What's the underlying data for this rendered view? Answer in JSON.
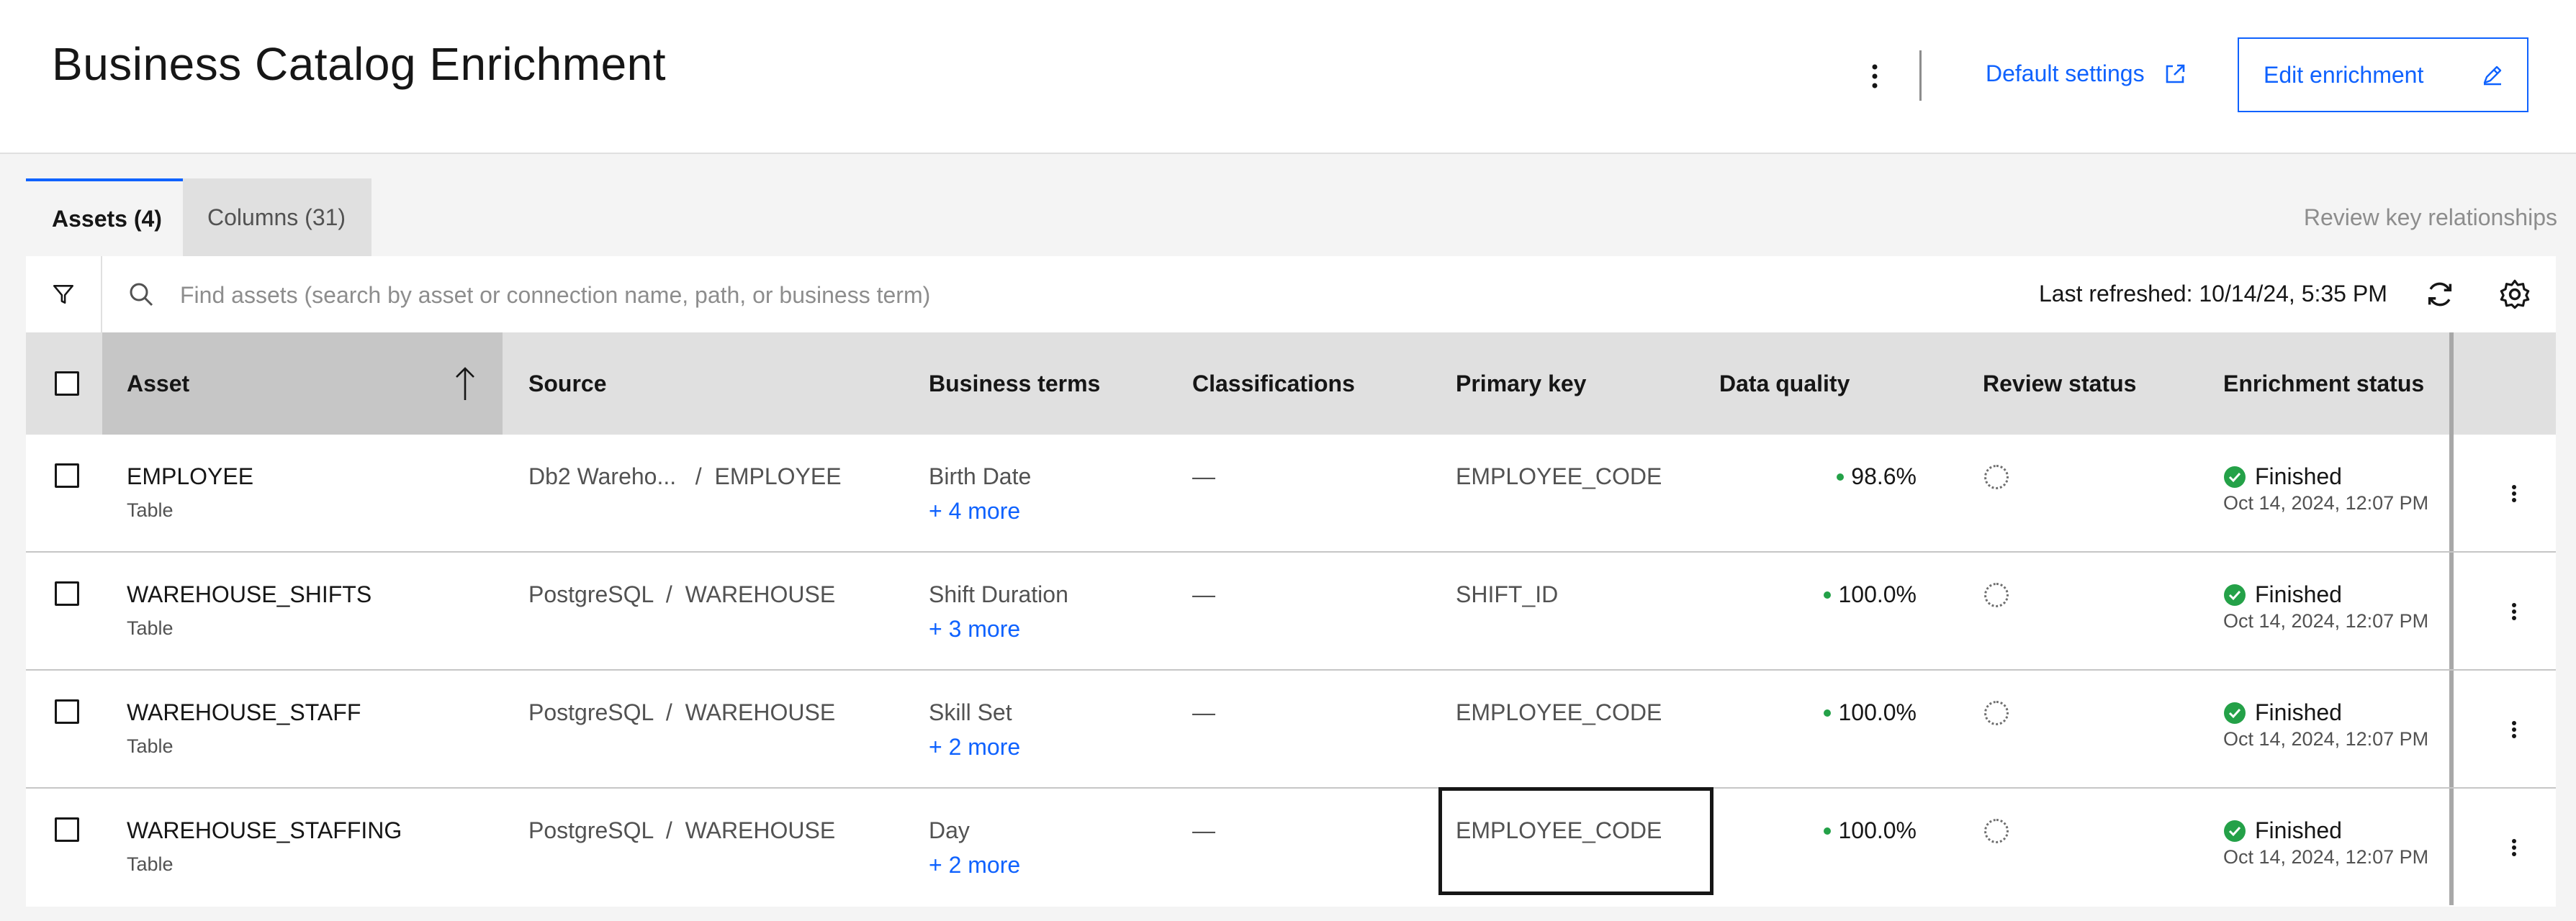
{
  "header": {
    "title": "Business Catalog Enrichment",
    "default_settings_label": "Default settings",
    "edit_enrichment_label": "Edit enrichment"
  },
  "tabs": [
    {
      "label": "Assets (4)",
      "selected": true
    },
    {
      "label": "Columns (31)",
      "selected": false
    }
  ],
  "review_key_relationships": "Review key relationships",
  "search": {
    "placeholder": "Find assets (search by asset or connection name, path, or business term)",
    "value": ""
  },
  "last_refreshed": "Last refreshed: 10/14/24, 5:35 PM",
  "table": {
    "columns": [
      "Asset",
      "Source",
      "Business terms",
      "Classifications",
      "Primary key",
      "Data quality",
      "Review status",
      "Enrichment status"
    ],
    "rows": [
      {
        "asset": "EMPLOYEE",
        "type": "Table",
        "source": "Db2 Wareho...   /  EMPLOYEE",
        "business_term": "Birth Date",
        "more_terms": "+ 4 more",
        "classifications": "—",
        "primary_key": "EMPLOYEE_CODE",
        "data_quality": "98.6%",
        "status": "Finished",
        "status_date": "Oct 14, 2024, 12:07 PM"
      },
      {
        "asset": "WAREHOUSE_SHIFTS",
        "type": "Table",
        "source": "PostgreSQL  /  WAREHOUSE",
        "business_term": "Shift Duration",
        "more_terms": "+ 3 more",
        "classifications": "—",
        "primary_key": "SHIFT_ID",
        "data_quality": "100.0%",
        "status": "Finished",
        "status_date": "Oct 14, 2024, 12:07 PM"
      },
      {
        "asset": "WAREHOUSE_STAFF",
        "type": "Table",
        "source": "PostgreSQL  /  WAREHOUSE",
        "business_term": "Skill Set",
        "more_terms": "+ 2 more",
        "classifications": "—",
        "primary_key": "EMPLOYEE_CODE",
        "data_quality": "100.0%",
        "status": "Finished",
        "status_date": "Oct 14, 2024, 12:07 PM"
      },
      {
        "asset": "WAREHOUSE_STAFFING",
        "type": "Table",
        "source": "PostgreSQL  /  WAREHOUSE",
        "business_term": "Day",
        "more_terms": "+ 2 more",
        "classifications": "—",
        "primary_key": "EMPLOYEE_CODE",
        "data_quality": "100.0%",
        "status": "Finished",
        "status_date": "Oct 14, 2024, 12:07 PM"
      }
    ]
  },
  "colors": {
    "accent": "#0f62fe",
    "success": "#24a148",
    "header_bg": "#e0e0e0"
  },
  "icons": [
    "overflow-menu-icon",
    "launch-icon",
    "edit-icon",
    "filter-icon",
    "search-icon",
    "refresh-icon",
    "settings-icon",
    "sort-ascending-icon",
    "review-pending-icon",
    "checkmark-filled-icon"
  ]
}
